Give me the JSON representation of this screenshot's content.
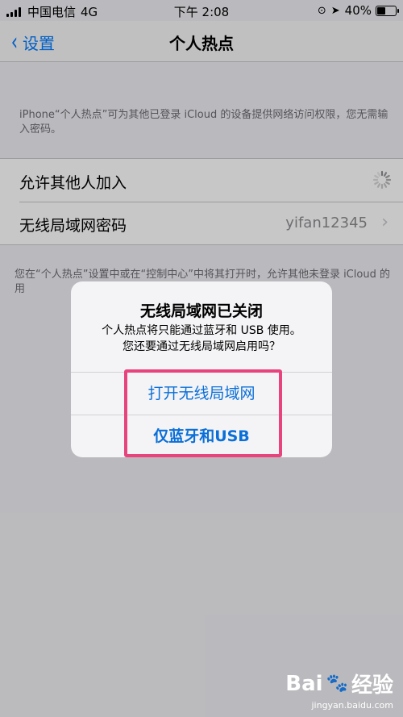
{
  "status_bar": {
    "carrier": "中国电信",
    "network": "4G",
    "time": "下午 2:08",
    "battery_percent": "40%",
    "battery_level": 0.4
  },
  "nav": {
    "back_label": "设置",
    "title": "个人热点"
  },
  "description_top": "iPhone“个人热点”可为其他已登录 iCloud 的设备提供网络访问权限，您无需输入密码。",
  "settings_rows": [
    {
      "label": "允许其他人加入"
    },
    {
      "label": "无线局域网密码",
      "value": "yifan12345"
    }
  ],
  "description_bottom": "您在“个人热点”设置中或在“控制中心”中将其打开时，允许其他未登录 iCloud 的用",
  "alert": {
    "title": "无线局域网已关闭",
    "message_line1": "个人热点将只能通过蓝牙和 USB 使用。",
    "message_line2": "您还要通过无线局域网启用吗？",
    "button_wifi": "打开无线局域网",
    "button_bt_usb": "仅蓝牙和USB"
  },
  "watermark": {
    "brand_left": "Bai",
    "brand_right": "经验",
    "url": "jingyan.baidu.com"
  },
  "colors": {
    "accent": "#007aff",
    "highlight": "#e8437d"
  }
}
